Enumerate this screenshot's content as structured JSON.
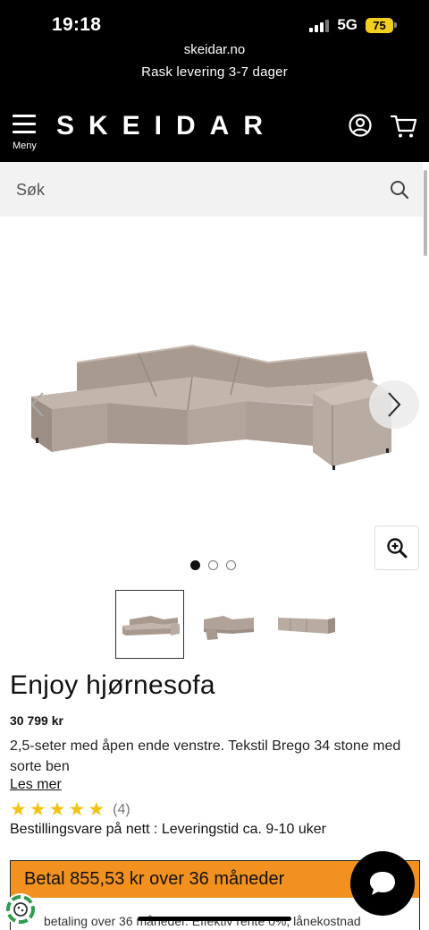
{
  "status_bar": {
    "time": "19:18",
    "network": "5G",
    "battery": "75"
  },
  "header": {
    "url": "skeidar.no",
    "delivery_text": "Rask levering 3-7 dager",
    "menu_label": "Meny",
    "logo_text": "SKEIDAR"
  },
  "search": {
    "placeholder": "Søk"
  },
  "gallery": {
    "total_images": 3,
    "active_index": 0,
    "thumbnails": [
      "sofa-corner",
      "sofa-modules",
      "sofa-back"
    ]
  },
  "product": {
    "title": "Enjoy hjørnesofa",
    "price": "30 799 kr",
    "description": "2,5-seter med åpen ende venstre. Tekstil Brego 34 stone med sorte ben",
    "read_more": "Les mer",
    "rating_stars": 5,
    "rating_count": "(4)",
    "availability": "Bestillingsvare på nett : Leveringstid ca. 9-10 uker"
  },
  "finance": {
    "headline": "Betal 855,53 kr over 36 måneder",
    "subtext": "betaling over 36 måneder. Effektiv rente 0%, lånekostnad"
  },
  "colors": {
    "header_bg": "#000000",
    "search_bg": "#f2f2f2",
    "finance_orange": "#f29120",
    "star_yellow": "#f2c314",
    "sofa": "#b5a69c"
  },
  "icons": {
    "menu": "hamburger-icon",
    "user": "user-icon",
    "cart": "cart-icon",
    "search": "search-icon",
    "zoom": "zoom-in-icon",
    "chat": "chat-icon",
    "cookie": "cookie-icon"
  }
}
